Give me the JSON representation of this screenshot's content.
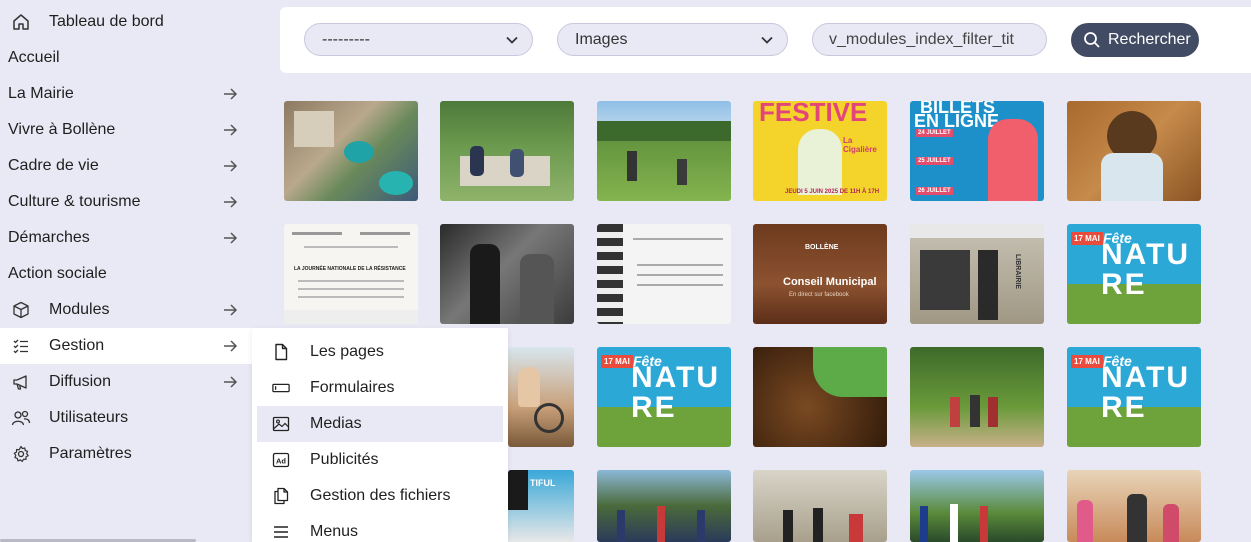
{
  "sidebar": {
    "items": [
      {
        "label": "Tableau de bord",
        "icon": "home-icon",
        "arrow": false
      },
      {
        "label": "Accueil",
        "icon": "",
        "arrow": false
      },
      {
        "label": "La Mairie",
        "icon": "",
        "arrow": true
      },
      {
        "label": "Vivre à Bollène",
        "icon": "",
        "arrow": true
      },
      {
        "label": "Cadre de vie",
        "icon": "",
        "arrow": true
      },
      {
        "label": "Culture & tourisme",
        "icon": "",
        "arrow": true
      },
      {
        "label": "Démarches",
        "icon": "",
        "arrow": true
      },
      {
        "label": "Action sociale",
        "icon": "",
        "arrow": false
      },
      {
        "label": "Modules",
        "icon": "cube-icon",
        "arrow": true
      },
      {
        "label": "Gestion",
        "icon": "checklist-icon",
        "arrow": true
      },
      {
        "label": "Diffusion",
        "icon": "megaphone-icon",
        "arrow": true
      },
      {
        "label": "Utilisateurs",
        "icon": "users-icon",
        "arrow": false
      },
      {
        "label": "Paramètres",
        "icon": "gear-icon",
        "arrow": false
      }
    ]
  },
  "filters": {
    "select_one_value": "---------",
    "select_two_value": "Images",
    "search_value": "v_modules_index_filter_tit",
    "search_button_label": "Rechercher"
  },
  "submenu": {
    "items": [
      {
        "label": "Les pages",
        "icon": "page-icon"
      },
      {
        "label": "Formulaires",
        "icon": "form-icon"
      },
      {
        "label": "Medias",
        "icon": "image-icon"
      },
      {
        "label": "Publicités",
        "icon": "ad-icon"
      },
      {
        "label": "Gestion des fichiers",
        "icon": "files-icon"
      },
      {
        "label": "Menus",
        "icon": "menu-icon"
      }
    ]
  },
  "thumb_texts": {
    "festive": "FESTIVE",
    "festive_sub": "La Cigalière",
    "festive_date": "JEUDI 5 JUIN 2025 DE 11H À 17H",
    "billets_line1": "BILLETS",
    "billets_line2": "EN LIGNE",
    "billets_tags": [
      "24 JUILLET",
      "25 JUILLET",
      "26 JUILLET"
    ],
    "bollene_label": "BOLLÈNE",
    "conseil": "Conseil Municipal",
    "conseil_sub": "En direct sur facebook",
    "librairie": "LIBRAIRIE",
    "nature_letters": "NATURE",
    "nature_date": "17 MAI",
    "fete": "Fête",
    "doc_title": "LA JOURNÉE NATIONALE DE LA RÉSISTANCE",
    "tiful": "TIFUL"
  },
  "colors": {
    "sidebar_bg": "#e9e9f5",
    "accent_button": "#414b63",
    "nature_bg": "#2ba8d6"
  }
}
